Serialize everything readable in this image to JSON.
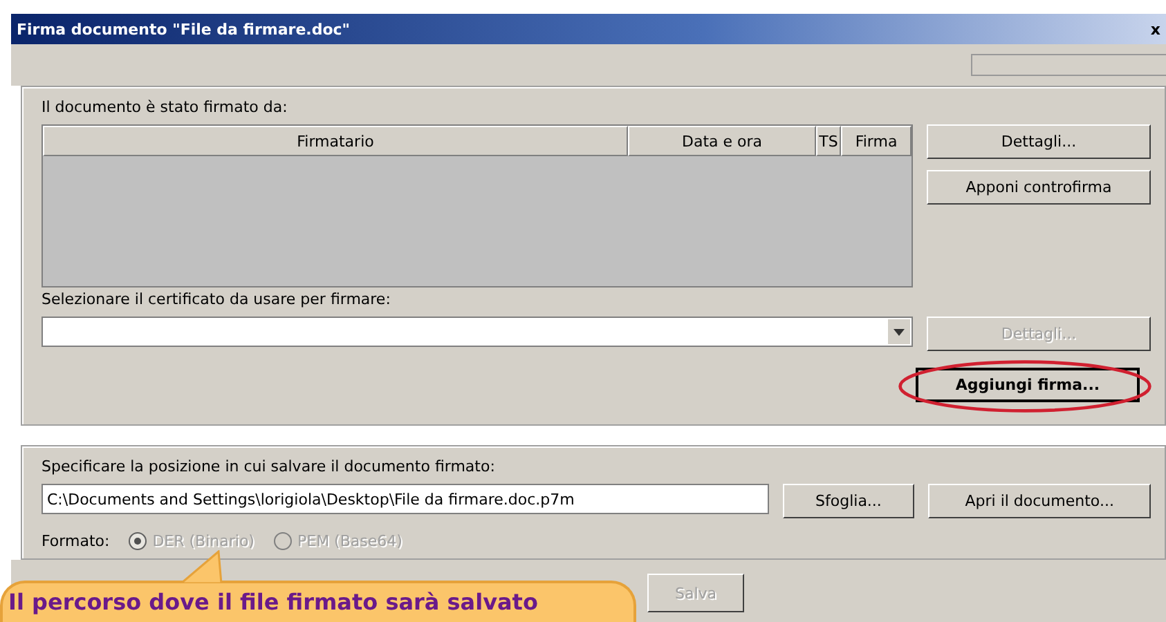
{
  "window": {
    "title": "Firma documento \"File da firmare.doc\"",
    "close": "x"
  },
  "signed_by": {
    "label": "Il documento è stato firmato da:",
    "columns": [
      "Firmatario",
      "Data e ora",
      "TS",
      "Firma"
    ]
  },
  "buttons_top": [
    "Dettagli...",
    "Apponi controfirma"
  ],
  "certificate": {
    "label": "Selezionare il certificato da usare per firmare:",
    "details_button": {
      "label": "Dettagli...",
      "disabled": true
    },
    "add_button": {
      "label": "Aggiungi firma...",
      "highlighted": true
    }
  },
  "save": {
    "label": "Specificare la posizione in cui salvare il documento firmato:",
    "path": "C:\\Documents and Settings\\lorigiola\\Desktop\\File da firmare.doc.p7m",
    "browse": "Sfoglia...",
    "open": "Apri il documento..."
  },
  "format": {
    "label": "Formato:",
    "options": [
      {
        "label": "DER (Binario)",
        "selected": true,
        "disabled": true
      },
      {
        "label": "PEM (Base64)",
        "selected": false,
        "disabled": true
      }
    ]
  },
  "bottom_button": {
    "label": "Salva",
    "disabled": true
  },
  "callout": {
    "text": "Il percorso dove il file firmato sarà salvato"
  }
}
